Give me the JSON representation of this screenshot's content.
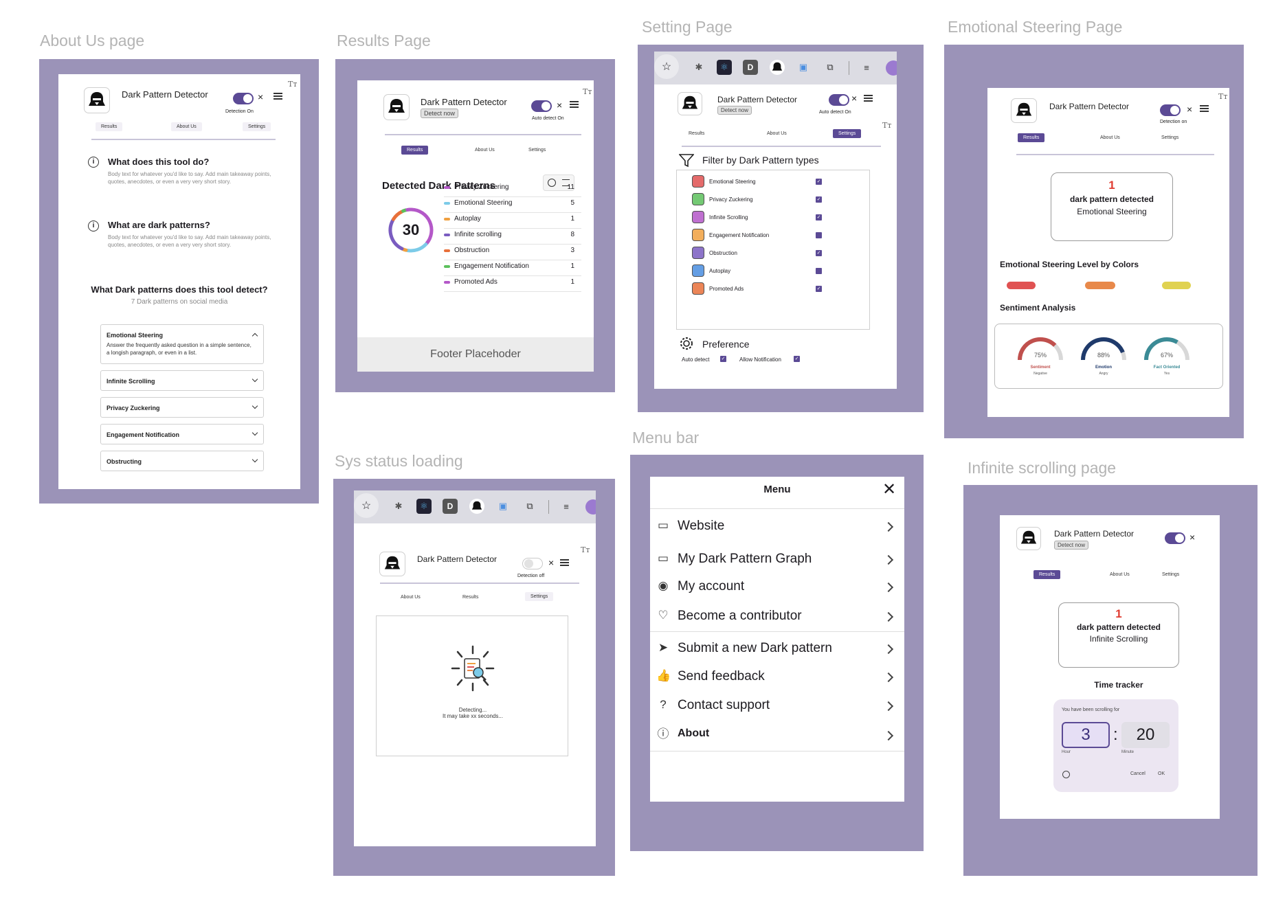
{
  "labels": {
    "about": "About Us page",
    "results": "Results Page",
    "setting": "Setting Page",
    "emotional": "Emotional Steering Page",
    "loading": "Sys status loading",
    "menubar": "Menu bar",
    "infinite": "Infinite scrolling page"
  },
  "common": {
    "app_title": "Dark Pattern Detector",
    "detect_now": "Detect now",
    "tt": "Tт",
    "close": "×",
    "tab_results": "Results",
    "tab_about": "About Us",
    "tab_settings": "Settings"
  },
  "about_page": {
    "toggle_caption": "Detection On",
    "q1_title": "What does this tool do?",
    "q1_body": "Body text for whatever you'd like to say. Add main takeaway points, quotes, anecdotes, or even a very very short story.",
    "q2_title": "What are dark patterns?",
    "q2_body": "Body text for whatever you'd like to say. Add main takeaway points, quotes, anecdotes, or even a very very short story.",
    "section_title": "What Dark patterns does this tool detect?",
    "section_sub": "7 Dark patterns on social media",
    "accordion_open_title": "Emotional Steering",
    "accordion_open_body": "Answer the frequently asked question in a simple sentence, a longish paragraph, or even in a list.",
    "accordion_items": [
      "Infinite Scrolling",
      "Privacy Zuckering",
      "Engagement Notification",
      "Obstructing"
    ]
  },
  "results_page": {
    "toggle_caption": "Auto detect On",
    "heading": "Detected Dark Patterns",
    "total": "30",
    "items": [
      {
        "label": "Privacy Zuckering",
        "count": "11",
        "color": "#b458c8"
      },
      {
        "label": "Emotional Steering",
        "count": "5",
        "color": "#7ccbe8"
      },
      {
        "label": "Autoplay",
        "count": "1",
        "color": "#f0a040"
      },
      {
        "label": "Infinite scrolling",
        "count": "8",
        "color": "#7a5cc0"
      },
      {
        "label": "Obstruction",
        "count": "3",
        "color": "#e8703a"
      },
      {
        "label": "Engagement Notification",
        "count": "1",
        "color": "#5cc05c"
      },
      {
        "label": "Promoted Ads",
        "count": "1",
        "color": "#b458c8"
      }
    ],
    "footer": "Footer Placehoder"
  },
  "setting_page": {
    "toggle_caption": "Auto detect On",
    "filter_title": "Filter by Dark Pattern types",
    "filters": [
      {
        "label": "Emotional Steering",
        "checked": true
      },
      {
        "label": "Privacy Zuckering",
        "checked": true
      },
      {
        "label": "Infinite Scrolling",
        "checked": true
      },
      {
        "label": "Engagement Notification",
        "checked": false
      },
      {
        "label": "Obstruction",
        "checked": true
      },
      {
        "label": "Autoplay",
        "checked": false
      },
      {
        "label": "Promoted Ads",
        "checked": true
      }
    ],
    "preference_title": "Preference",
    "pref_auto_detect": "Auto detect",
    "pref_allow_notification": "Allow Notification"
  },
  "emotional_page": {
    "toggle_caption": "Detection on",
    "count": "1",
    "detected_label": "dark pattern detected",
    "detected_type": "Emotional Steering",
    "level_title": "Emotional Steering Level by Colors",
    "level_colors": [
      "#e05252",
      "#e8894a",
      "#e0d250"
    ],
    "sentiment_title": "Sentiment Analysis",
    "gauges": [
      {
        "value": 0.75,
        "pct": "75%",
        "name": "Sentiment",
        "sub": "Negative",
        "color": "#c0504d"
      },
      {
        "value": 0.88,
        "pct": "88%",
        "name": "Emotion",
        "sub": "Angry",
        "color": "#1f3a6b"
      },
      {
        "value": 0.67,
        "pct": "67%",
        "name": "Fact Oriented",
        "sub": "Yes",
        "color": "#3b8b96"
      }
    ]
  },
  "loading_page": {
    "toggle_caption": "Detection off",
    "tab_about": "About Us",
    "tab_results": "Results",
    "tab_settings": "Settings",
    "line1": "Detecting...",
    "line2": "It may take xx seconds..."
  },
  "menu": {
    "title": "Menu",
    "items": [
      {
        "label": "Website",
        "icon": "window-icon"
      },
      {
        "label": "My Dark Pattern Graph",
        "icon": "rectangle-icon"
      },
      {
        "label": "My account",
        "icon": "account-icon"
      },
      {
        "label": "Become a contributor",
        "icon": "heart-icon"
      },
      {
        "label": "Submit a new Dark pattern",
        "icon": "send-icon"
      },
      {
        "label": "Send feedback",
        "icon": "thumbs-up-icon"
      },
      {
        "label": "Contact support",
        "icon": "help-icon"
      },
      {
        "label": "About",
        "icon": "info-icon"
      }
    ]
  },
  "infinite_page": {
    "count": "1",
    "detected_label": "dark pattern detected",
    "detected_type": "Infinite Scrolling",
    "tracker_title": "Time tracker",
    "tracker_caption": "You have been scrolling for",
    "hours": "3",
    "colon": ":",
    "minutes": "20",
    "hour_label": "Hour",
    "minute_label": "Minute",
    "cancel": "Cancel",
    "ok": "OK"
  },
  "colors": {
    "frame": "#9b93b8",
    "accent": "#5b4a95",
    "alert_red": "#e03c31"
  }
}
